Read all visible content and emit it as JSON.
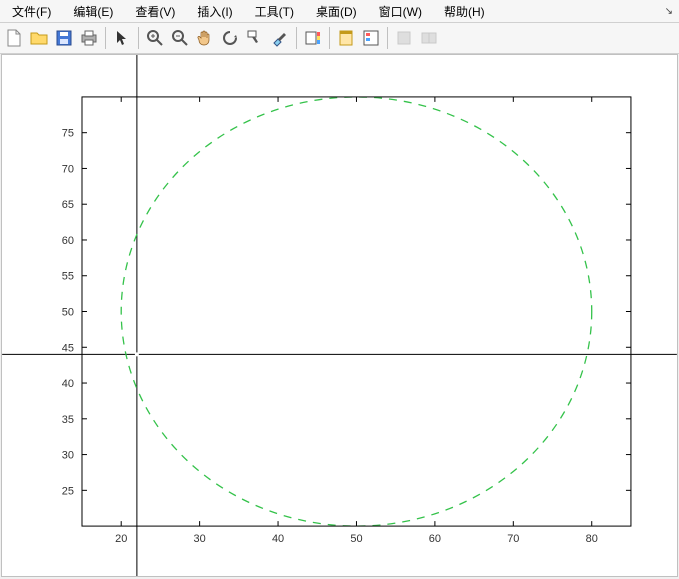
{
  "menu": {
    "items": [
      "文件(F)",
      "编辑(E)",
      "查看(V)",
      "插入(I)",
      "工具(T)",
      "桌面(D)",
      "窗口(W)",
      "帮助(H)"
    ]
  },
  "toolbar": {
    "groups": [
      [
        "new-file-icon",
        "open-folder-icon",
        "save-disk-icon",
        "print-icon"
      ],
      [
        "pointer-icon"
      ],
      [
        "zoom-in-icon",
        "zoom-out-icon",
        "pan-hand-icon",
        "rotate-3d-icon",
        "data-cursor-icon",
        "brush-icon"
      ],
      [
        "insert-colorbar-icon"
      ],
      [
        "hide-plot-icon",
        "insert-legend-icon"
      ],
      [
        "link-off-icon",
        "link-on-icon"
      ]
    ],
    "disabled": [
      "link-off-icon",
      "link-on-icon"
    ]
  },
  "chart_data": {
    "type": "line",
    "title": "",
    "xlabel": "",
    "ylabel": "",
    "xlim": [
      15,
      85
    ],
    "ylim": [
      20,
      80
    ],
    "xticks": [
      20,
      30,
      40,
      50,
      60,
      70,
      80
    ],
    "yticks": [
      25,
      30,
      35,
      40,
      45,
      50,
      55,
      60,
      65,
      70,
      75
    ],
    "series": [
      {
        "name": "dashed-circle",
        "style": "dashed",
        "color": "#34c24a",
        "center": [
          50,
          50
        ],
        "radius": 30
      }
    ],
    "annotations": {
      "crosshair": {
        "x": 22,
        "y": 44
      }
    }
  }
}
